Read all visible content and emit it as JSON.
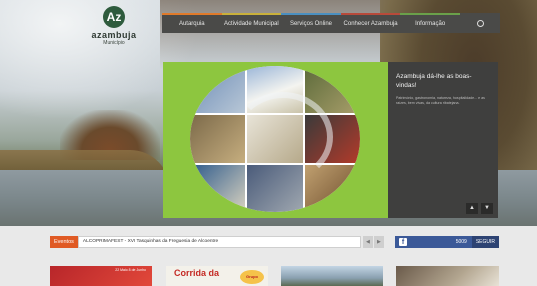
{
  "logo": {
    "mark": "Az",
    "name": "azambuja",
    "subtitle": "Município"
  },
  "nav": {
    "items": [
      "Autarquia",
      "Actividade Municipal",
      "Serviços Online",
      "Conhecer Azambuja",
      "Informação"
    ],
    "search_icon": "search-icon"
  },
  "welcome": {
    "title": "Azambuja dá-lhe as boas-vindas!",
    "text": "Património, gastronomia, natureza, hospitalidade... e as raízes, bem vivas, da cultura ribatejana."
  },
  "slider": {
    "prev": "▲",
    "next": "▼"
  },
  "events": {
    "tag": "Eventos",
    "headline": "ALCOPRIMAFEST - XVI Tasquinhas da Freguesia de Alcoentre",
    "prev": "◀",
    "next": "▶"
  },
  "facebook": {
    "icon": "f",
    "count": "5009",
    "follow_label": "SEGUIR",
    "color": "#3b5998"
  },
  "thumbs": {
    "t0_text": "22 Maio 8 de Junho",
    "t1_text": "Corrida da",
    "t1_badge": "Grupo"
  },
  "colors": {
    "accent_green": "#8dc63f",
    "events_orange": "#e05a24",
    "nav_bg": "#4a4a48"
  }
}
